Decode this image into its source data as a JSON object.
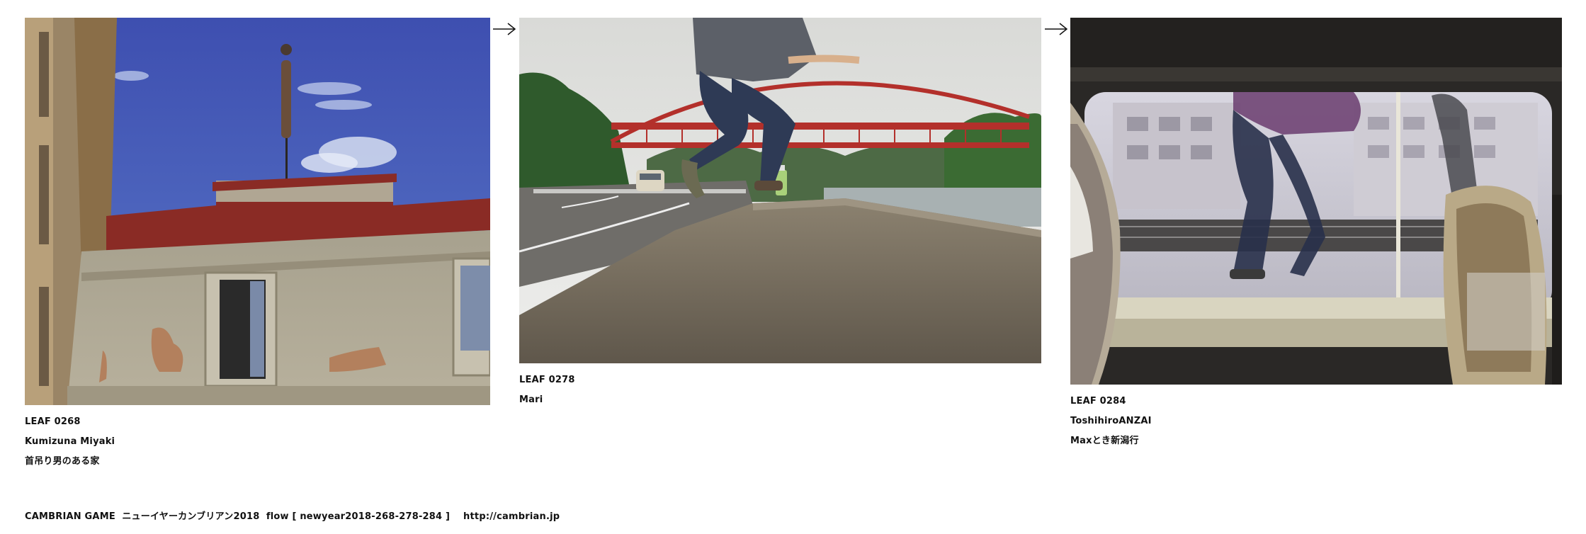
{
  "leaves": [
    {
      "leaf_id": "LEAF 0268",
      "author": "Kumizuna Miyaki",
      "title": "首吊り男のある家"
    },
    {
      "leaf_id": "LEAF 0278",
      "author": "Mari",
      "title": ""
    },
    {
      "leaf_id": "LEAF 0284",
      "author": "ToshihiroANZAI",
      "title": "Maxとき新潟行"
    }
  ],
  "arrow_icon": "right-arrow-icon",
  "footer": {
    "text": "CAMBRIAN GAME  ニューイヤーカンブリアン2018  flow [ newyear2018-268-278-284 ]    http://cambrian.jp"
  }
}
